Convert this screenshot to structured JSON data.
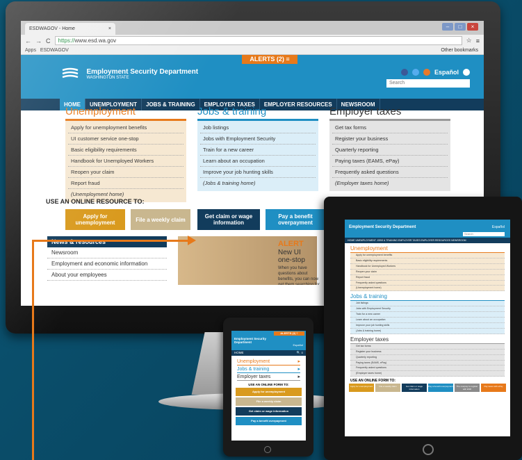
{
  "browser": {
    "tab_title": "ESDWAGOV - Home",
    "tab_close": "×",
    "url": "https://www.esd.wa.gov",
    "url_scheme": "https://",
    "url_host": "www.esd.wa.gov",
    "bookmarks": [
      "Apps",
      "ESDWAGOV"
    ],
    "other_bookmarks": "Other bookmarks",
    "nav_back": "←",
    "nav_forward": "→",
    "nav_reload": "C",
    "star": "☆",
    "menu": "≡"
  },
  "site": {
    "alerts_label": "ALERTS (2) ≡",
    "org_name": "Employment Security Department",
    "org_sub": "WASHINGTON STATE",
    "espanol": "Español",
    "search_placeholder": "Search",
    "nav": [
      "HOME",
      "UNEMPLOYMENT",
      "JOBS & TRAINING",
      "EMPLOYER TAXES",
      "EMPLOYER RESOURCES",
      "NEWSROOM"
    ],
    "unemployment": {
      "title": "Unemployment",
      "items": [
        "Apply for unemployment benefits",
        "UI customer service one-stop",
        "Basic eligibility requirements",
        "Handbook for Unemployed Workers",
        "Reopen your claim",
        "Report fraud"
      ],
      "home": "(Unemployment home)"
    },
    "jobs": {
      "title": "Jobs & training",
      "items": [
        "Job listings",
        "Jobs with Employment Security",
        "Train for a new career",
        "Learn about an occupation",
        "Improve your job hunting skills"
      ],
      "home": "(Jobs & training home)"
    },
    "taxes": {
      "title": "Employer taxes",
      "items": [
        "Get tax forms",
        "Register your business",
        "Quarterly reporting",
        "Paying taxes (EAMS, ePay)",
        "Frequently asked questions"
      ],
      "home": "(Employer taxes home)"
    },
    "online_label": "USE AN ONLINE RESOURCE TO:",
    "buttons": [
      "Apply for unemployment",
      "File a weekly claim",
      "Get claim or wage information",
      "Pay a benefit overpayment"
    ],
    "news": {
      "title": "News & resources",
      "items": [
        "Newsroom",
        "Employment and economic information",
        "About your employees"
      ]
    },
    "alert_panel": {
      "title": "ALERT",
      "subtitle1": "New UI",
      "subtitle2": "one-stop",
      "para": "When you have questions about benefits, you can now get them searching for"
    }
  },
  "tablet": {
    "org_name": "Employment Security Department",
    "espanol": "Español",
    "search_placeholder": "Search",
    "nav": "HOME  UNEMPLOYMENT  JOBS & TRAINING  EMPLOYER TAXES  EMPLOYER RESOURCES  NEWSROOM",
    "unemployment": {
      "title": "Unemployment",
      "items": [
        "Apply for unemployment benefits",
        "Basic eligibility requirements",
        "Handbook for Unemployed Workers",
        "Reopen your claim",
        "Report fraud",
        "Frequently asked questions",
        "(Unemployment home)"
      ]
    },
    "jobs": {
      "title": "Jobs & training",
      "items": [
        "Job listings",
        "Jobs with Employment Security",
        "Train for a new career",
        "Learn about an occupation",
        "Improve your job hunting skills",
        "(Jobs & training home)"
      ]
    },
    "taxes": {
      "title": "Employer taxes",
      "items": [
        "Get tax forms",
        "Register your business",
        "Quarterly reporting",
        "Paying taxes (EAMS, ePay)",
        "Frequently asked questions",
        "(Employer taxes home)"
      ]
    },
    "online_label": "USE AN ONLINE FORM TO:",
    "buttons": [
      "Apply for unemployment",
      "File a weekly claim",
      "Get claim or wage information",
      "Pay a benefit overpayment",
      "The overpay to register with ESD",
      "Pay taxes with ePay"
    ]
  },
  "phone": {
    "alerts_label": "ALERTS (2) ≡",
    "org_name": "Employment Security Department",
    "espanol": "Español",
    "nav_home": "HOME",
    "nav_icons": "🔍 ≡",
    "links": [
      "Unemployment",
      "Jobs & training",
      "Employer taxes"
    ],
    "link_arrow": "▸",
    "online_label": "USE AN ONLINE FORM TO:",
    "buttons": [
      "Apply for unemployment",
      "File a weekly claim",
      "Get claim or wage information",
      "Pay a benefit overpayment"
    ]
  },
  "colors": {
    "esd_blue": "#1f8fc3",
    "navy": "#123c5c",
    "orange": "#e7791a",
    "tan": "#f6e8d2",
    "light_blue": "#dbeef8",
    "gray": "#e4e4e4",
    "gold": "#d99a1e"
  }
}
